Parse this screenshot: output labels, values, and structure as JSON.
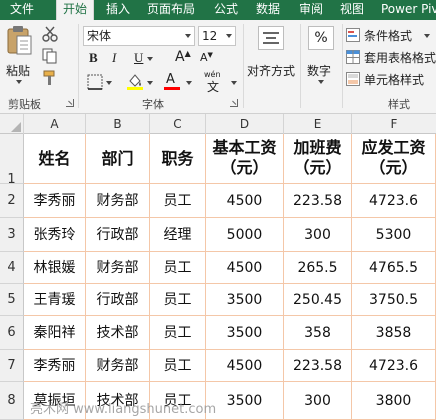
{
  "tabs": [
    "文件",
    "开始",
    "插入",
    "页面布局",
    "公式",
    "数据",
    "审阅",
    "视图",
    "Power Piv"
  ],
  "ribbon": {
    "clipboard": {
      "paste": "粘贴",
      "label": "剪贴板"
    },
    "font": {
      "name": "宋体",
      "size": "12",
      "bold": "B",
      "italic": "I",
      "underline": "U",
      "label": "字体",
      "wen": "wén",
      "wen_char": "文",
      "big_a": "A",
      "small_a": "A"
    },
    "alignment": {
      "label": "对齐方式"
    },
    "number": {
      "symbol": "%",
      "label": "数字"
    },
    "styles": {
      "conditional": "条件格式",
      "table": "套用表格格式",
      "cell": "单元格样式",
      "label": "样式"
    }
  },
  "grid": {
    "columns": [
      "A",
      "B",
      "C",
      "D",
      "E",
      "F"
    ],
    "rows": [
      "1",
      "2",
      "3",
      "4",
      "5",
      "6",
      "7",
      "8"
    ],
    "headers": [
      "姓名",
      "部门",
      "职务",
      "基本工资",
      "加班费",
      "应发工资"
    ],
    "header_sub": [
      "",
      "",
      "",
      "（元）",
      "（元）",
      "（元）"
    ],
    "data": [
      [
        "李秀丽",
        "财务部",
        "员工",
        "4500",
        "223.58",
        "4723.6"
      ],
      [
        "张秀玲",
        "行政部",
        "经理",
        "5000",
        "300",
        "5300"
      ],
      [
        "林银媛",
        "财务部",
        "员工",
        "4500",
        "265.5",
        "4765.5"
      ],
      [
        "王青瑗",
        "行政部",
        "员工",
        "3500",
        "250.45",
        "3750.5"
      ],
      [
        "秦阳祥",
        "技术部",
        "员工",
        "3500",
        "358",
        "3858"
      ],
      [
        "李秀丽",
        "财务部",
        "员工",
        "4500",
        "223.58",
        "4723.6"
      ],
      [
        "莫振垣",
        "技术部",
        "员工",
        "3500",
        "300",
        "3800"
      ]
    ]
  },
  "watermark": "亮术网 www.liangshunet.com",
  "colors": {
    "tab_bar": "#217346",
    "grid_line": "#f4c7a8",
    "font_color_bar": "#ff0000",
    "fill_color_bar": "#ffff00"
  }
}
